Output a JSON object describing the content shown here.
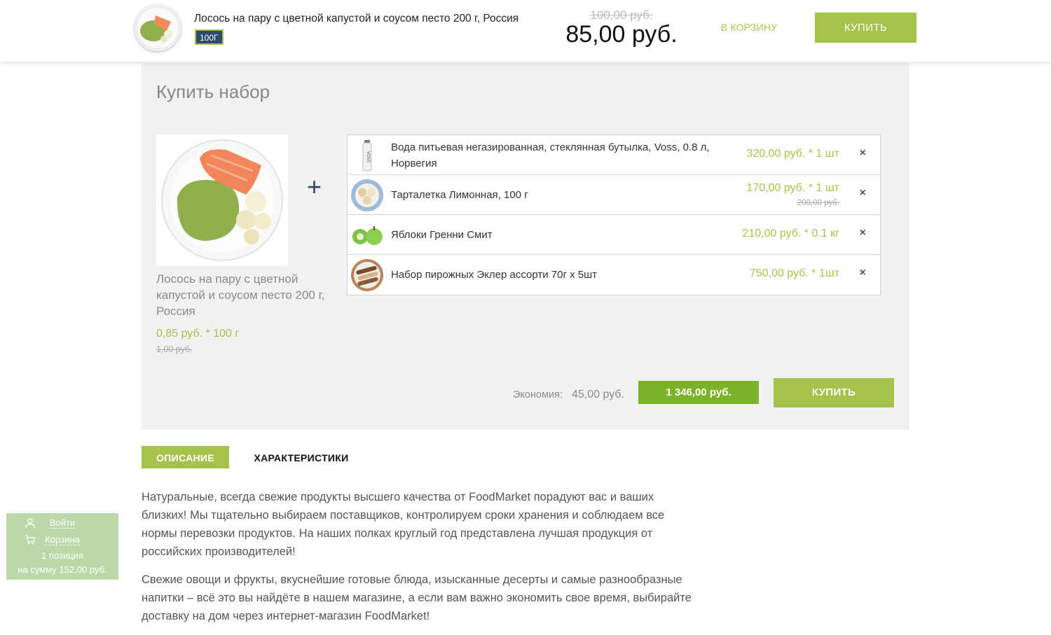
{
  "topbar": {
    "product_name": "Лосось на пару с цветной капустой и соусом песто 200 г, Россия",
    "weight_badge": "100Г",
    "old_price": "100,00 руб.",
    "price": "85,00 руб.",
    "cart_link": "В КОРЗИНУ",
    "buy_label": "КУПИТЬ"
  },
  "bundle": {
    "title": "Купить набор",
    "main": {
      "name": "Лосось на пару с цветной капустой и соусом песто 200 г, Россия",
      "price": "0,85 руб. * 100 г",
      "old_price": "1,00 руб."
    },
    "plus": "+",
    "items": [
      {
        "name": "Вода питьевая негазированная, стеклянная бутылка, Voss, 0.8 л, Норвегия",
        "price": "320,00 руб. * 1 шт",
        "old_price": "",
        "icon": "voss-bottle-image"
      },
      {
        "name": "Тарталетка Лимонная, 100 г",
        "price": "170,00 руб. * 1 шт",
        "old_price": "200,00 руб.",
        "icon": "tartlet-image"
      },
      {
        "name": "Яблоки Гренни Смит",
        "price": "210,00 руб. * 0.1 кг",
        "old_price": "",
        "icon": "apples-image"
      },
      {
        "name": "Набор пирожных Эклер ассорти 70г х 5шт",
        "price": "750,00 руб. * 1шт",
        "old_price": "",
        "icon": "eclairs-image"
      }
    ],
    "remove_symbol": "×",
    "savings_label": "Экономия:",
    "savings_value": "45,00 руб.",
    "total": "1 346,00 руб.",
    "buy_label": "КУПИТЬ"
  },
  "tabs": {
    "description": "ОПИСАНИЕ",
    "specs": "ХАРАКТЕРИСТИКИ"
  },
  "description": {
    "p1": "Натуральные, всегда свежие продукты высшего качества от FoodMarket порадуют вас и ваших близких! Мы тщательно выбираем поставщиков, контролируем сроки хранения и соблюдаем все нормы перевозки продуктов. На наших полках круглый год представлена лучшая продукция от российских производителей!",
    "p2": "Свежие овощи и фрукты, вкуснейшие готовые блюда, изысканные десерты и самые разнообразные напитки – всё это вы найдёте в нашем магазине, а если вам важно экономить свое время, выбирайте доставку на дом через интернет-магазин FoodMarket!"
  },
  "widget": {
    "login": "Войти",
    "cart": "Корзина",
    "count": "1 позиция",
    "sum": "на сумму 152,00 руб."
  },
  "colors": {
    "accent": "#a5c34a",
    "accent_dark": "#7cb32a",
    "badge_bg": "#2d4a6a",
    "panel_bg": "#f1f1f1",
    "widget_bg": "#bcd8a8"
  }
}
